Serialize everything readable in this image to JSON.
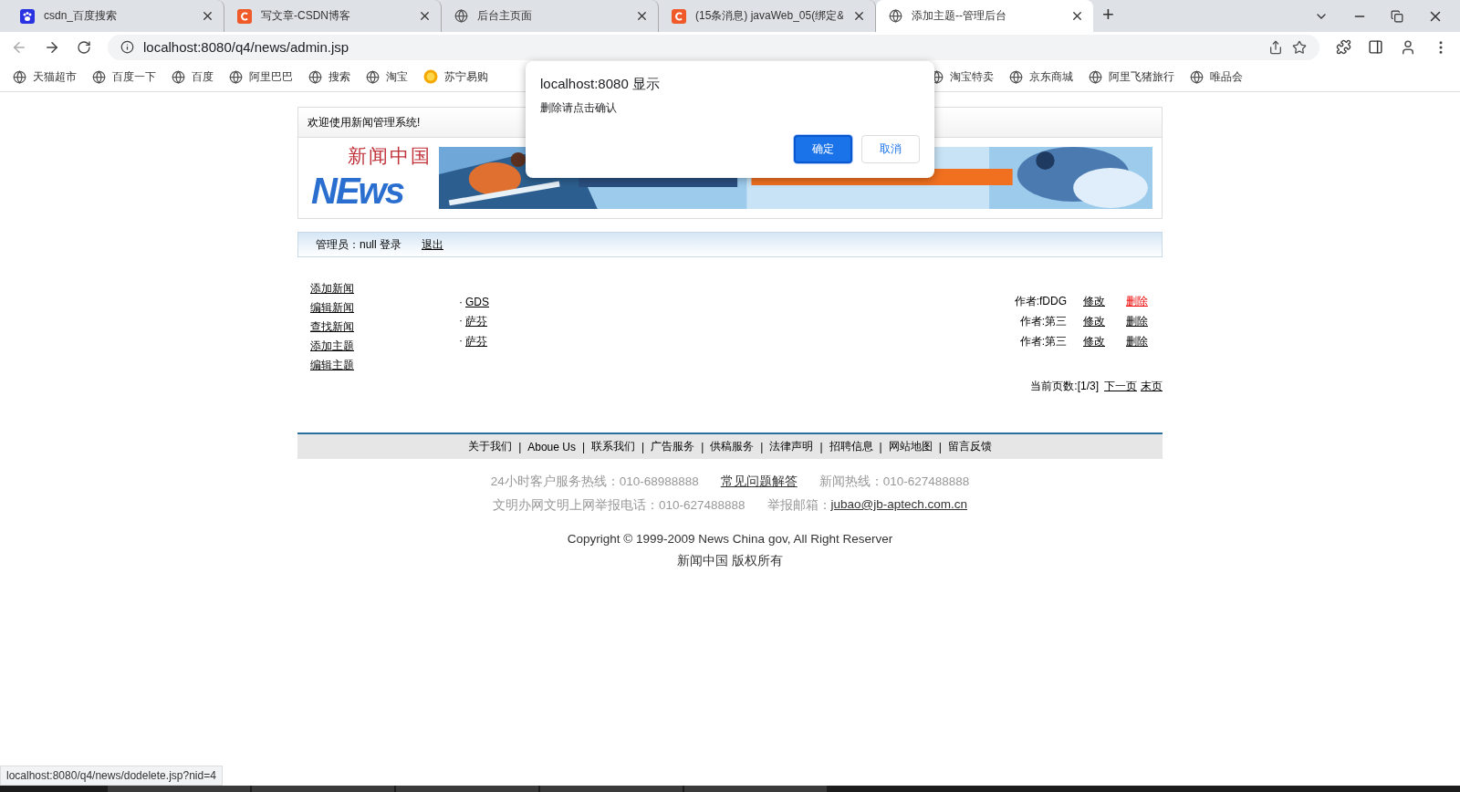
{
  "browser": {
    "tabs": [
      {
        "title": "csdn_百度搜索",
        "kind": "paw",
        "selected": false
      },
      {
        "title": "写文章-CSDN博客",
        "kind": "c",
        "selected": false
      },
      {
        "title": "后台主页面",
        "kind": "globe",
        "selected": false
      },
      {
        "title": "(15条消息) javaWeb_05(绑定&",
        "kind": "c",
        "selected": false
      },
      {
        "title": "添加主题--管理后台",
        "kind": "globe",
        "selected": true
      }
    ],
    "new_tab": "+",
    "address": "localhost:8080/q4/news/admin.jsp",
    "bookmarks_left": [
      {
        "label": "天猫超市",
        "kind": "globe"
      },
      {
        "label": "百度一下",
        "kind": "globe"
      },
      {
        "label": "百度",
        "kind": "globe"
      },
      {
        "label": "阿里巴巴",
        "kind": "globe"
      },
      {
        "label": "搜索",
        "kind": "globe"
      },
      {
        "label": "淘宝",
        "kind": "globe"
      },
      {
        "label": "苏宁易购",
        "kind": "sun"
      }
    ],
    "bookmarks_right": [
      {
        "label": "淘宝特卖",
        "kind": "globe"
      },
      {
        "label": "京东商城",
        "kind": "globe"
      },
      {
        "label": "阿里飞猪旅行",
        "kind": "globe"
      },
      {
        "label": "唯品会",
        "kind": "globe"
      }
    ],
    "status_url": "localhost:8080/q4/news/dodelete.jsp?nid=4"
  },
  "page": {
    "welcome": "欢迎使用新闻管理系统!",
    "logo_title": "新闻中国",
    "logo_mark": "NEws",
    "admin_label": "管理员：null 登录",
    "logout": "退出",
    "menu": [
      "添加新闻",
      "编辑新闻",
      "查找新闻",
      "添加主题",
      "编辑主题"
    ],
    "news": [
      {
        "bullet": "·",
        "title": "GDS",
        "author": "作者:fDDG",
        "edit": "修改",
        "delete": "删除",
        "highlighted": true
      },
      {
        "bullet": "·",
        "title": "萨芬",
        "author": "作者:第三",
        "edit": "修改",
        "delete": "删除",
        "highlighted": false
      },
      {
        "bullet": "·",
        "title": "萨芬",
        "author": "作者:第三",
        "edit": "修改",
        "delete": "删除",
        "highlighted": false
      }
    ],
    "pager": {
      "label": "当前页数:[1/3]",
      "next": "下一页",
      "last": "末页"
    },
    "footer_links": [
      "关于我们",
      "Aboue Us",
      "联系我们",
      "广告服务",
      "供稿服务",
      "法律声明",
      "招聘信息",
      "网站地图",
      "留言反馈"
    ],
    "footer_sep": "|",
    "hotline": "24小时客户服务热线：010-68988888",
    "faq": "常见问题解答",
    "news_hotline": "新闻热线：010-627488888",
    "report_phone": "文明办网文明上网举报电话：010-627488888",
    "report_email_label": "举报邮箱：",
    "report_email": "jubao@jb-aptech.com.cn",
    "copyright": "Copyright © 1999-2009 News China gov, All Right Reserver",
    "rights": "新闻中国 版权所有"
  },
  "dialog": {
    "title": "localhost:8080 显示",
    "message": "删除请点击确认",
    "buttons": [
      {
        "label": "确定",
        "primary": true
      },
      {
        "label": "取消",
        "primary": false
      }
    ]
  }
}
